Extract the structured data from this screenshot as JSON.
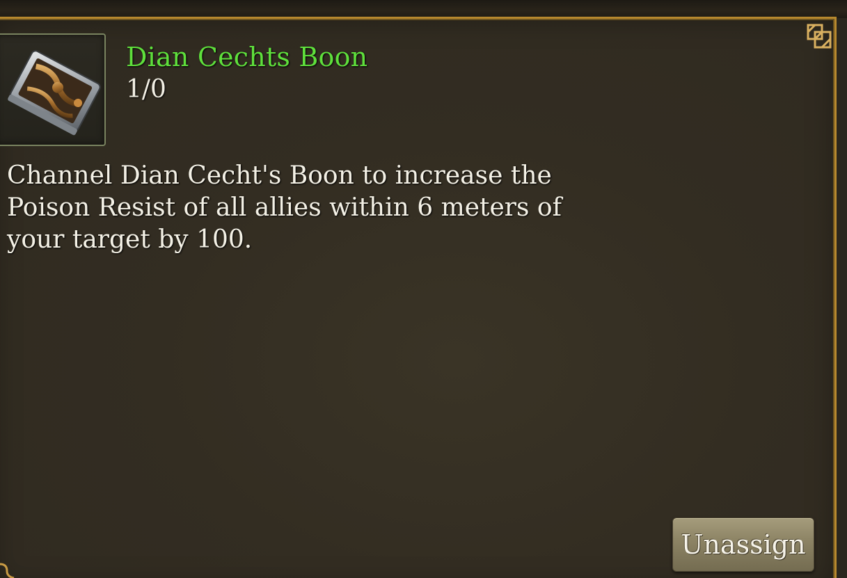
{
  "ability": {
    "name": "Dian Cechts Boon",
    "rank": "1/0",
    "icon": "ornate-tome-icon",
    "description": "Channel Dian Cecht's Boon to increase the Poison Resist of all allies within 6 meters of your target by 100."
  },
  "actions": {
    "unassign_label": "Unassign"
  },
  "colors": {
    "title": "#5fe03c",
    "text": "#f4f1e6",
    "panel": "#332d22",
    "border_gold": "#b8892e"
  }
}
